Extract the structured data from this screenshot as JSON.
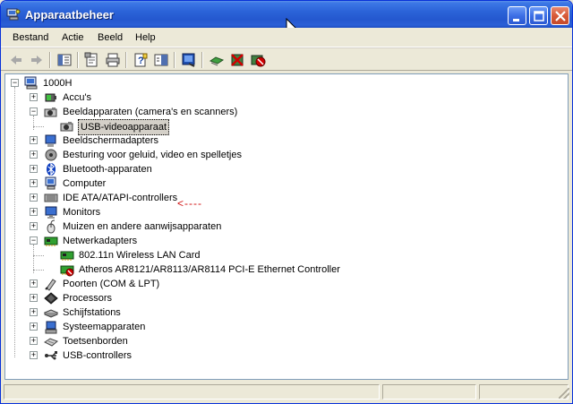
{
  "window": {
    "title": "Apparaatbeheer"
  },
  "menu": [
    "Bestand",
    "Actie",
    "Beeld",
    "Help"
  ],
  "tree": {
    "root": "1000H",
    "items": [
      {
        "label": "Accu's",
        "icon": "battery-icon",
        "expander": "+"
      },
      {
        "label": "Beeldapparaten (camera's en scanners)",
        "icon": "camera-icon",
        "expander": "-"
      },
      {
        "label": "USB-videoapparaat",
        "icon": "camera-icon",
        "child": true,
        "selected": true
      },
      {
        "label": "Beeldschermadapters",
        "icon": "display-adapter-icon",
        "expander": "+"
      },
      {
        "label": "Besturing voor geluid, video en spelletjes",
        "icon": "sound-icon",
        "expander": "+"
      },
      {
        "label": "Bluetooth-apparaten",
        "icon": "bluetooth-icon",
        "expander": "+"
      },
      {
        "label": "Computer",
        "icon": "computer-icon",
        "expander": "+"
      },
      {
        "label": "IDE ATA/ATAPI-controllers",
        "icon": "ide-controller-icon",
        "expander": "+"
      },
      {
        "label": "Monitors",
        "icon": "monitor-icon",
        "expander": "+"
      },
      {
        "label": "Muizen en andere aanwijsapparaten",
        "icon": "mouse-icon",
        "expander": "+"
      },
      {
        "label": "Netwerkadapters",
        "icon": "network-adapter-icon",
        "expander": "-"
      },
      {
        "label": "802.11n Wireless LAN Card",
        "icon": "network-adapter-icon",
        "child": true
      },
      {
        "label": "Atheros AR8121/AR8113/AR8114 PCI-E Ethernet Controller",
        "icon": "network-adapter-disabled-icon",
        "child": true
      },
      {
        "label": "Poorten (COM & LPT)",
        "icon": "port-icon",
        "expander": "+"
      },
      {
        "label": "Processors",
        "icon": "processor-icon",
        "expander": "+"
      },
      {
        "label": "Schijfstations",
        "icon": "disk-drive-icon",
        "expander": "+"
      },
      {
        "label": "Systeemapparaten",
        "icon": "system-device-icon",
        "expander": "+"
      },
      {
        "label": "Toetsenborden",
        "icon": "keyboard-icon",
        "expander": "+"
      },
      {
        "label": "USB-controllers",
        "icon": "usb-icon",
        "expander": "+"
      }
    ]
  },
  "annotation": "<----",
  "colors": {
    "titlebar": "#2457cf",
    "annotation": "#d01010"
  }
}
